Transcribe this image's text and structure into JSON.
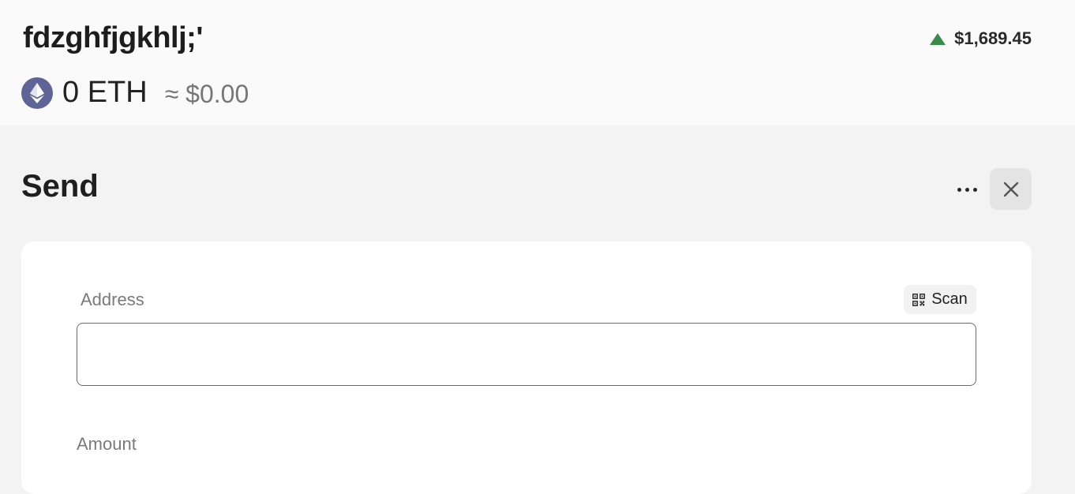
{
  "header": {
    "account_name": "fdzghfjgkhlj;'",
    "price": "$1,689.45",
    "balance_amount": "0 ETH",
    "balance_fiat": "≈ $0.00"
  },
  "send": {
    "title": "Send"
  },
  "form": {
    "address_label": "Address",
    "scan_label": "Scan",
    "address_value": "",
    "amount_label": "Amount"
  },
  "colors": {
    "price_up": "#3a8a4e",
    "eth_badge": "#5f6496"
  },
  "icons": {
    "price_trend": "triangle-up-icon",
    "token": "ethereum-icon",
    "more": "ellipsis-icon",
    "close": "close-icon",
    "scan": "qr-code-icon"
  }
}
